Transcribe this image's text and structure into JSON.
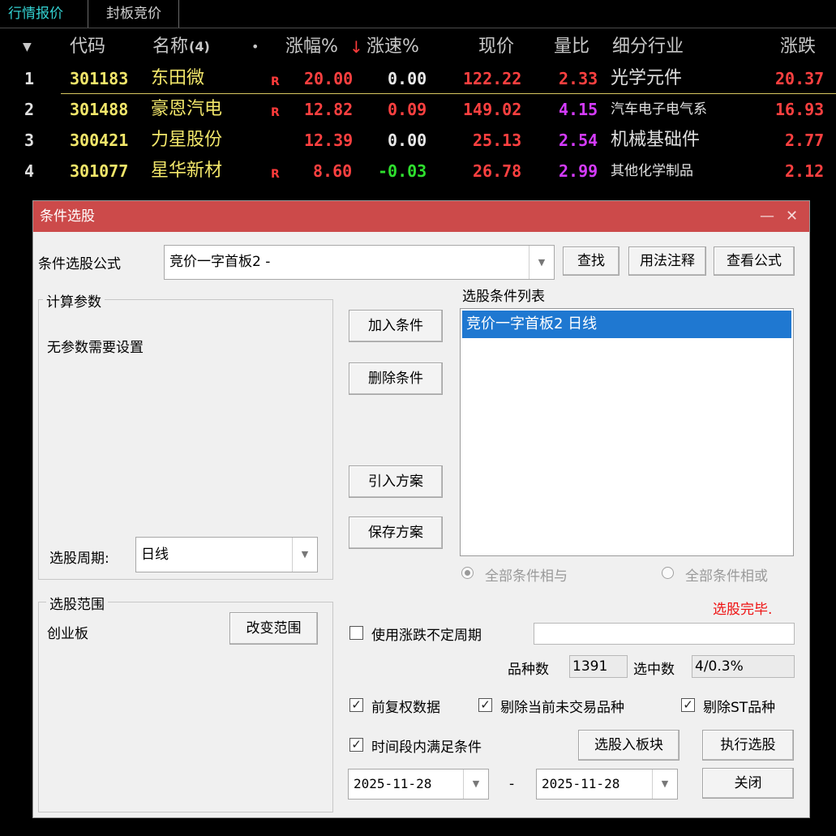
{
  "tabs": [
    "行情报价",
    "封板竞价"
  ],
  "table": {
    "headers": {
      "menu": "▼",
      "code": "代码",
      "name": "名称",
      "count": "(4)",
      "dot": "•",
      "change": "涨幅%",
      "sort_arrow": "↓",
      "speed": "涨速%",
      "price": "现价",
      "vol_ratio": "量比",
      "industry": "细分行业",
      "rise": "涨跌"
    },
    "rows": [
      {
        "no": "1",
        "code": "301183",
        "name": "东田微",
        "flag": "R",
        "change": "20.00",
        "speed": "0.00",
        "price": "122.22",
        "vol_ratio": "2.33",
        "industry": "光学元件",
        "rise": "20.37"
      },
      {
        "no": "2",
        "code": "301488",
        "name": "豪恩汽电",
        "flag": "R",
        "change": "12.82",
        "speed": "0.09",
        "price": "149.02",
        "vol_ratio": "4.15",
        "industry": "汽车电子电气系",
        "rise": "16.93"
      },
      {
        "no": "3",
        "code": "300421",
        "name": "力星股份",
        "flag": "",
        "change": "12.39",
        "speed": "0.00",
        "price": "25.13",
        "vol_ratio": "2.54",
        "industry": "机械基础件",
        "rise": "2.77"
      },
      {
        "no": "4",
        "code": "301077",
        "name": "星华新材",
        "flag": "R",
        "change": "8.60",
        "speed": "-0.03",
        "price": "26.78",
        "vol_ratio": "2.99",
        "industry": "其他化学制品",
        "rise": "2.12"
      }
    ]
  },
  "dialog": {
    "title": "条件选股",
    "minimize": "—",
    "close": "✕",
    "formula_label": "条件选股公式",
    "formula_value": "竞价一字首板2  -",
    "find_btn": "查找",
    "usage_btn": "用法注释",
    "view_btn": "查看公式",
    "params_group": "计算参数",
    "params_text": "无参数需要设置",
    "period_label": "选股周期:",
    "period_value": "日线",
    "add_btn": "加入条件",
    "delete_btn": "删除条件",
    "import_btn": "引入方案",
    "save_btn": "保存方案",
    "list_label": "选股条件列表",
    "list_items": [
      "竞价一字首板2  日线"
    ],
    "radio_and": "全部条件相与",
    "radio_or": "全部条件相或",
    "status": "选股完毕.",
    "range_group": "选股范围",
    "range_value": "创业板",
    "change_range_btn": "改变范围",
    "variable_period_label": "使用涨跌不定周期",
    "variety_label": "品种数",
    "variety_value": "1391",
    "selected_label": "选中数",
    "selected_value": "4/0.3%",
    "adjust_label": "前复权数据",
    "exclude_untraded_label": "剔除当前未交易品种",
    "exclude_st_label": "剔除ST品种",
    "time_range_label": "时间段内满足条件",
    "to_block_btn": "选股入板块",
    "run_btn": "执行选股",
    "date_from": "2025-11-28",
    "date_sep": "-",
    "date_to": "2025-11-28",
    "close_btn": "关闭",
    "check_mark": "✓",
    "dropdown_arrow": "▼"
  }
}
